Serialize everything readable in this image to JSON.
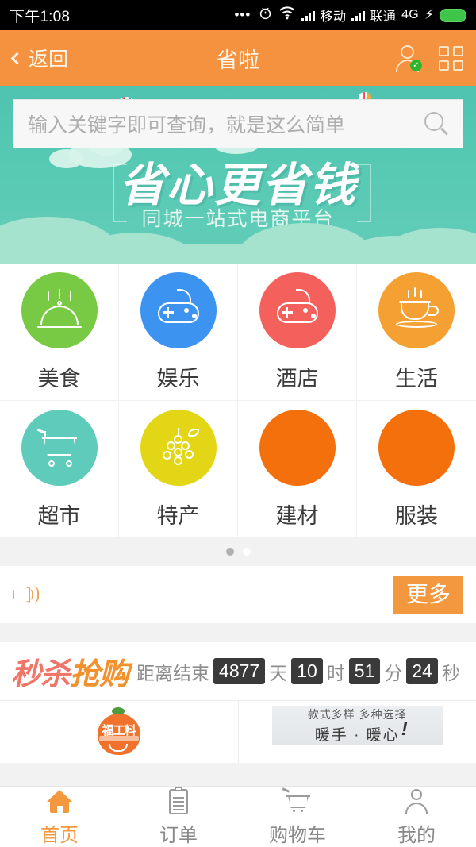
{
  "statusbar": {
    "time": "下午1:08",
    "dots": "•••",
    "carrier1": "移动",
    "carrier2": "联通",
    "network": "4G",
    "bolt": "⚡"
  },
  "header": {
    "back_label": "返回",
    "title": "省啦",
    "user_icon": "user-verified-icon",
    "grid_icon": "grid-menu-icon",
    "bg_color": "#f4923f"
  },
  "search": {
    "placeholder": "输入关键字即可查询，就是这么简单",
    "value": "",
    "icon": "search-icon"
  },
  "banner": {
    "headline": "省心更省钱",
    "subhead": "同城一站式电商平台",
    "bg_color": "#56c9b3",
    "cloud_color": "#a5e3cf"
  },
  "categories": [
    {
      "label": "美食",
      "icon": "food-cloche-icon",
      "color": "#78c943"
    },
    {
      "label": "娱乐",
      "icon": "gamepad-icon",
      "color": "#3d93f0"
    },
    {
      "label": "酒店",
      "icon": "gamepad-icon",
      "color": "#f4605c"
    },
    {
      "label": "生活",
      "icon": "coffee-cup-icon",
      "color": "#f5a033"
    },
    {
      "label": "超市",
      "icon": "shopping-cart-icon",
      "color": "#5ecbbb"
    },
    {
      "label": "特产",
      "icon": "grapes-icon",
      "color": "#e2d617"
    },
    {
      "label": "建材",
      "icon": "placeholder-icon",
      "color": "#f4700d"
    },
    {
      "label": "服装",
      "icon": "placeholder-icon",
      "color": "#f4700d"
    }
  ],
  "pager": {
    "total": 2,
    "active": 0
  },
  "announce": {
    "speaker_icon": "speaker-icon",
    "text": "",
    "more_label": "更多"
  },
  "flash": {
    "logo_part1": "秒杀",
    "logo_part2": "抢购",
    "countdown_label": "距离结束",
    "days": "4877",
    "days_unit": "天",
    "hours": "10",
    "hours_unit": "时",
    "minutes": "51",
    "minutes_unit": "分",
    "seconds": "24",
    "seconds_unit": "秒",
    "products": [
      {
        "badge": "福工料",
        "line1": "",
        "line2": ""
      },
      {
        "badge": "",
        "line1": "款式多样  多种选择",
        "line2": "暖手 · 暖心",
        "bang": "!"
      }
    ]
  },
  "tabbar": [
    {
      "label": "首页",
      "icon": "home-icon",
      "active": true
    },
    {
      "label": "订单",
      "icon": "clipboard-icon",
      "active": false
    },
    {
      "label": "购物车",
      "icon": "cart-icon",
      "active": false
    },
    {
      "label": "我的",
      "icon": "person-icon",
      "active": false
    }
  ]
}
